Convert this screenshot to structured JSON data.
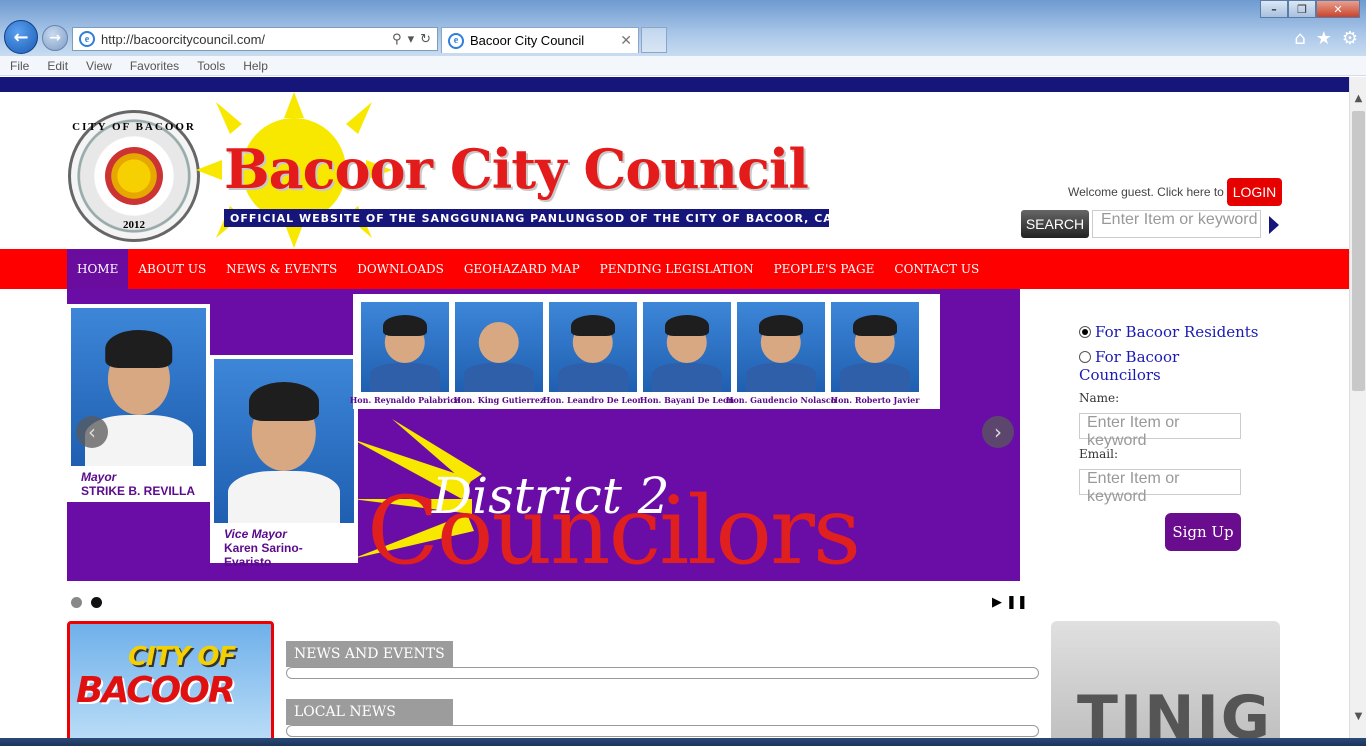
{
  "browser": {
    "url": "http://bacoorcitycouncil.com/",
    "tab_title": "Bacoor City Council",
    "menu": [
      "File",
      "Edit",
      "View",
      "Favorites",
      "Tools",
      "Help"
    ]
  },
  "header": {
    "seal_text": "CITY OF BACOOR",
    "seal_year": "2012",
    "title_part1": "Bacoor",
    "title_part2": "City Council",
    "subtitle": "OFFICIAL WEBSITE OF THE SANGGUNIANG PANLUNGSOD OF THE CITY OF BACOOR, CAVITE",
    "welcome": "Welcome guest. Click here to",
    "login_label": "LOGIN",
    "search_label": "SEARCH",
    "search_placeholder": "Enter Item or keyword"
  },
  "nav": {
    "items": [
      "HOME",
      "ABOUT US",
      "NEWS & EVENTS",
      "DOWNLOADS",
      "GEOHAZARD MAP",
      "PENDING LEGISLATION",
      "PEOPLE'S PAGE",
      "CONTACT US"
    ],
    "active": "HOME"
  },
  "slider": {
    "mayor_title": "Mayor",
    "mayor_name": "STRIKE B. REVILLA",
    "vice_title": "Vice Mayor",
    "vice_name": "Karen Sarino-Evaristo",
    "councilors": [
      "Hon. Reynaldo Palabrica",
      "Hon. King Gutierrez",
      "Hon. Leandro De Leon",
      "Hon. Bayani De Leon",
      "Hon. Gaudencio Nolasco",
      "Hon. Roberto Javier"
    ],
    "heading_line1": "District 2",
    "heading_line2": "Councilors",
    "slide_count": 2,
    "active_slide": 2
  },
  "signup": {
    "option_residents": "For Bacoor Residents",
    "option_councilors": "For Bacoor Councilors",
    "name_label": "Name:",
    "email_label": "Email:",
    "input_placeholder": "Enter Item or keyword",
    "button_label": "Sign Up"
  },
  "bottom": {
    "city_of": "CITY OF",
    "bacoor": "BACOOR",
    "news_events": "NEWS AND EVENTS",
    "local_news": "LOCAL NEWS",
    "tinig": "TINIG"
  },
  "colors": {
    "nav_red": "#ff0000",
    "brand_purple": "#6a0ca6",
    "navy": "#15157a"
  }
}
